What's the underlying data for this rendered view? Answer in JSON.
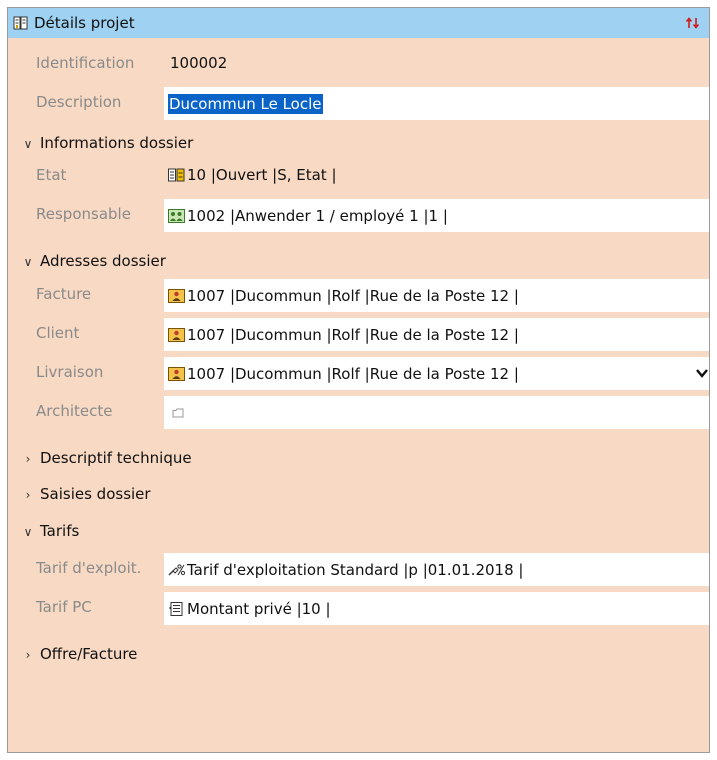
{
  "window": {
    "title": "Détails projet"
  },
  "fields": {
    "identification": {
      "label": "Identification",
      "value": "100002"
    },
    "description": {
      "label": "Description",
      "value": "Ducommun Le Locle"
    }
  },
  "sections": {
    "informations": {
      "title": "Informations dossier",
      "expanded": true,
      "etat": {
        "label": "Etat",
        "value": "10 |Ouvert |S, Etat |"
      },
      "responsable": {
        "label": "Responsable",
        "value": "1002 |Anwender 1 / employé 1 |1 |"
      }
    },
    "adresses": {
      "title": "Adresses dossier",
      "expanded": true,
      "facture": {
        "label": "Facture",
        "value": "1007 |Ducommun |Rolf |Rue de la Poste 12 |"
      },
      "client": {
        "label": "Client",
        "value": "1007 |Ducommun |Rolf |Rue de la Poste 12 |"
      },
      "livraison": {
        "label": "Livraison",
        "value": "1007 |Ducommun |Rolf |Rue de la Poste 12 |"
      },
      "architecte": {
        "label": "Architecte",
        "value": ""
      }
    },
    "descriptif": {
      "title": "Descriptif technique",
      "expanded": false
    },
    "saisies": {
      "title": "Saisies dossier",
      "expanded": false
    },
    "tarifs": {
      "title": "Tarifs",
      "expanded": true,
      "exploit": {
        "label": "Tarif d'exploit.",
        "value": "Tarif d'exploitation Standard |p |01.01.2018 |"
      },
      "pc": {
        "label": "Tarif PC",
        "value": "Montant privé |10 |"
      }
    },
    "offre": {
      "title": "Offre/Facture",
      "expanded": false
    }
  },
  "icons": {
    "chevron_expanded": "chevron-down-icon",
    "chevron_collapsed": "chevron-right-icon"
  },
  "colors": {
    "panel_background": "#f8d9c4",
    "titlebar_background": "#9fd2f2",
    "selection": "#0a64c8",
    "label_text": "#8a8a8a"
  }
}
